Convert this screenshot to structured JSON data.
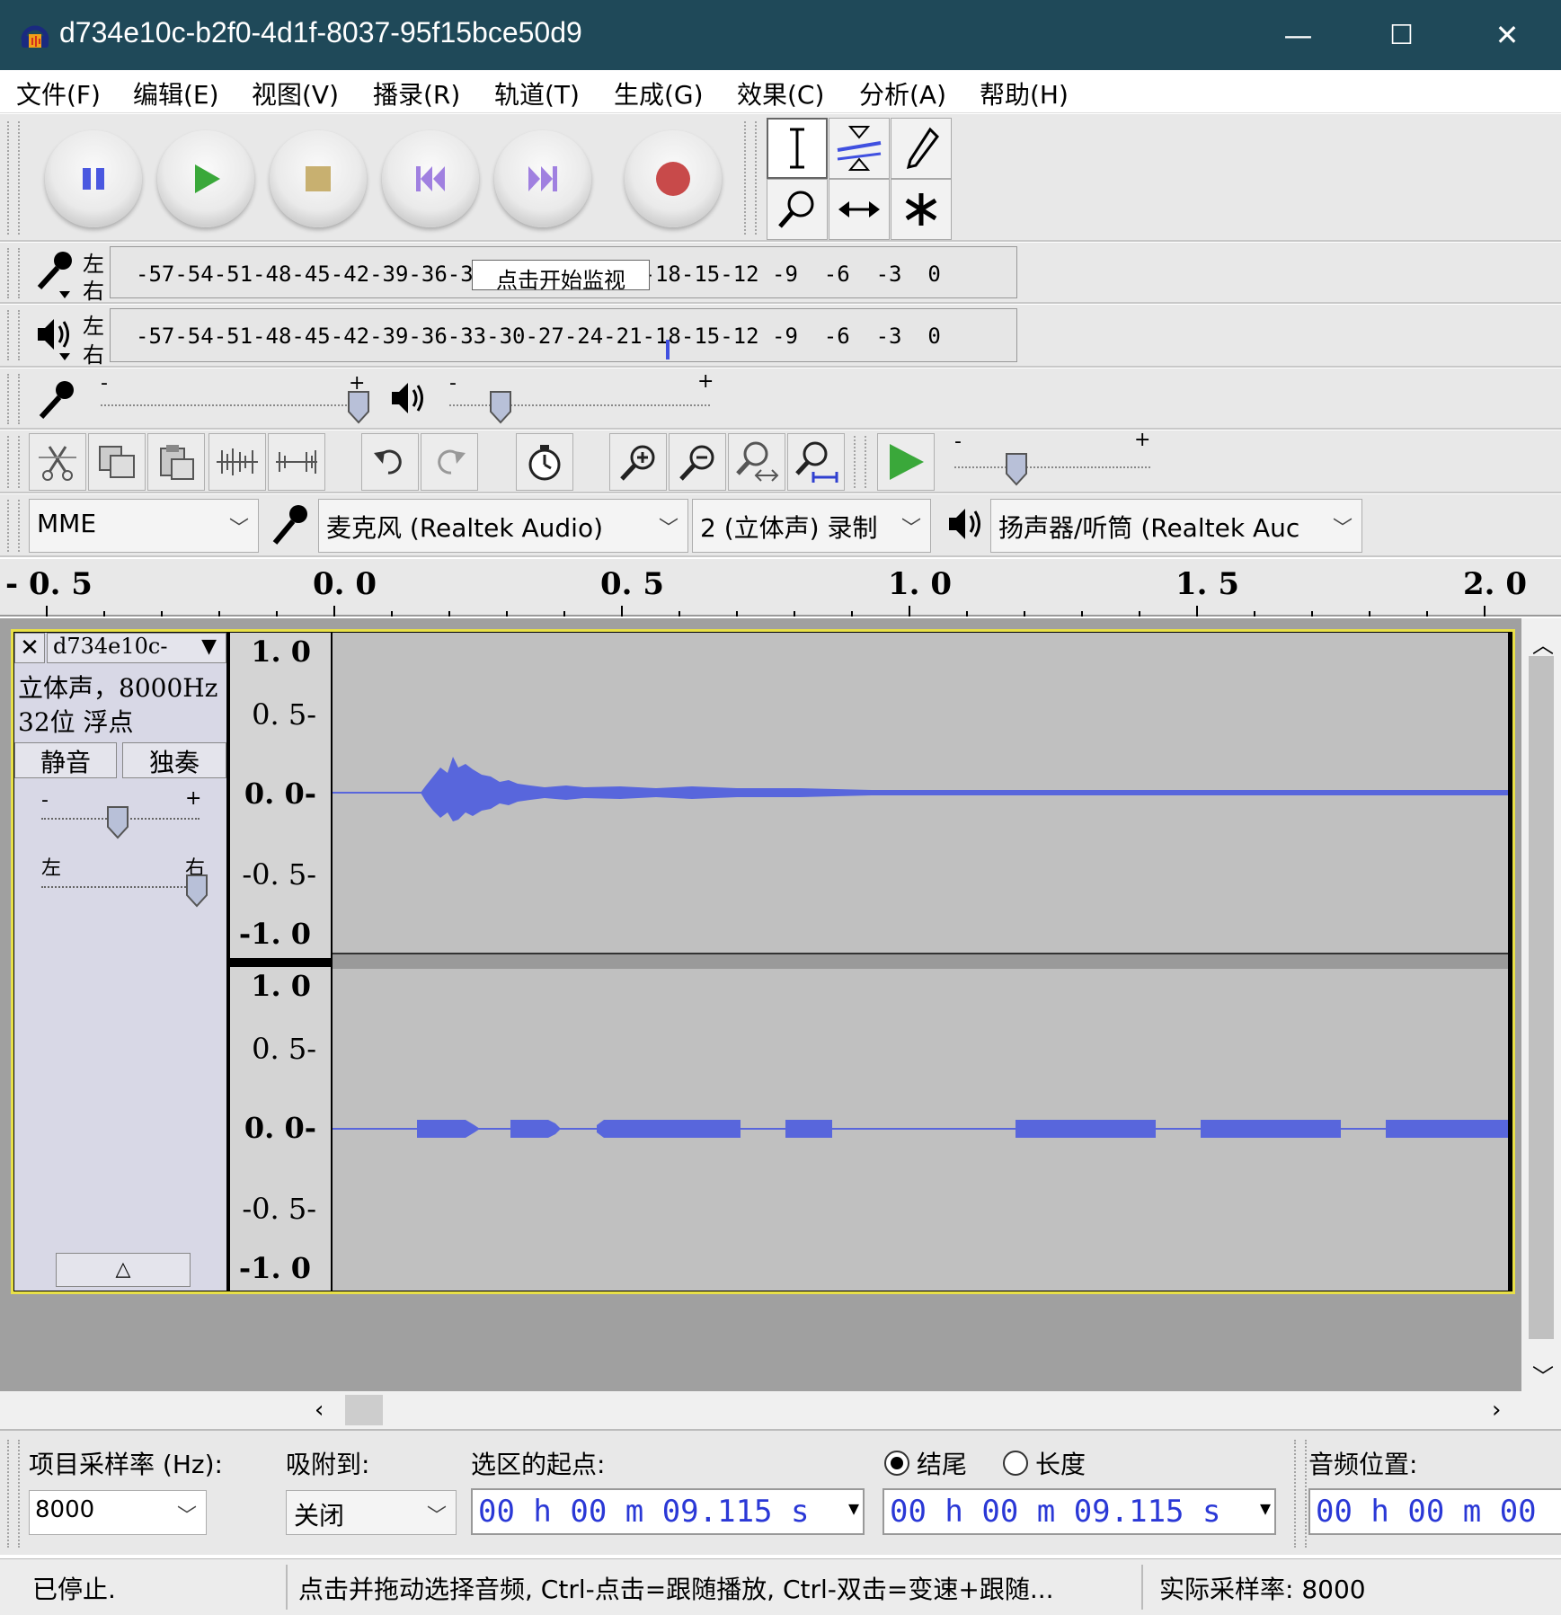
{
  "window": {
    "title": "d734e10c-b2f0-4d1f-8037-95f15bce50d9",
    "minimize": "—",
    "maximize": "☐",
    "close": "✕"
  },
  "menu": [
    "文件(F)",
    "编辑(E)",
    "视图(V)",
    "播录(R)",
    "轨道(T)",
    "生成(G)",
    "效果(C)",
    "分析(A)",
    "帮助(H)"
  ],
  "meters": {
    "left": "左",
    "right": "右",
    "record_scale": "-57-54-51-48-45-42-39-36-33-30-27-24-21-18-15-12 -9  -6  -3  0",
    "play_scale": "-57-54-51-48-45-42-39-36-33-30-27-24-21-18-15-12 -9  -6  -3  0",
    "monitor_button": "点击开始监视"
  },
  "sliders": {
    "minus": "-",
    "plus": "+"
  },
  "devices": {
    "host": "MME",
    "mic": "麦克风 (Realtek Audio)",
    "channels": "2 (立体声) 录制",
    "speaker": "扬声器/听筒 (Realtek Auc"
  },
  "ruler": {
    "labels": [
      "- 0. 5",
      "0. 0",
      "0. 5",
      "1. 0",
      "1. 5",
      "2. 0"
    ]
  },
  "track": {
    "name": "d734e10c-",
    "info1": "立体声，8000Hz",
    "info2": "32位 浮点",
    "mute": "静音",
    "solo": "独奏",
    "gain_minus": "-",
    "gain_plus": "+",
    "pan_left": "左",
    "pan_right": "右",
    "axis_top": [
      "1. 0",
      "0. 5-",
      "0. 0-",
      "-0. 5-",
      "-1. 0"
    ],
    "axis_bottom": [
      "1. 0",
      "0. 5-",
      "0. 0-",
      "-0. 5-",
      "-1. 0"
    ]
  },
  "selection": {
    "rate_label": "项目采样率 (Hz):",
    "rate_value": "8000",
    "snap_label": "吸附到:",
    "snap_value": "关闭",
    "start_label": "选区的起点:",
    "start_value": "00 h 00 m 09.115 s",
    "end_radio": "结尾",
    "length_radio": "长度",
    "end_value": "00 h 00 m 09.115 s",
    "pos_label": "音频位置:",
    "pos_value": "00 h 00 m 00"
  },
  "status": {
    "state": "已停止.",
    "hint": "点击并拖动选择音频, Ctrl-点击=跟随播放, Ctrl-双击=变速+跟随...",
    "rate": "实际采样率: 8000"
  },
  "colors": {
    "titlebar": "#1f4959",
    "waveform": "#5866dc",
    "selection_border": "#e8e048",
    "time_digits": "#2a38d6"
  }
}
